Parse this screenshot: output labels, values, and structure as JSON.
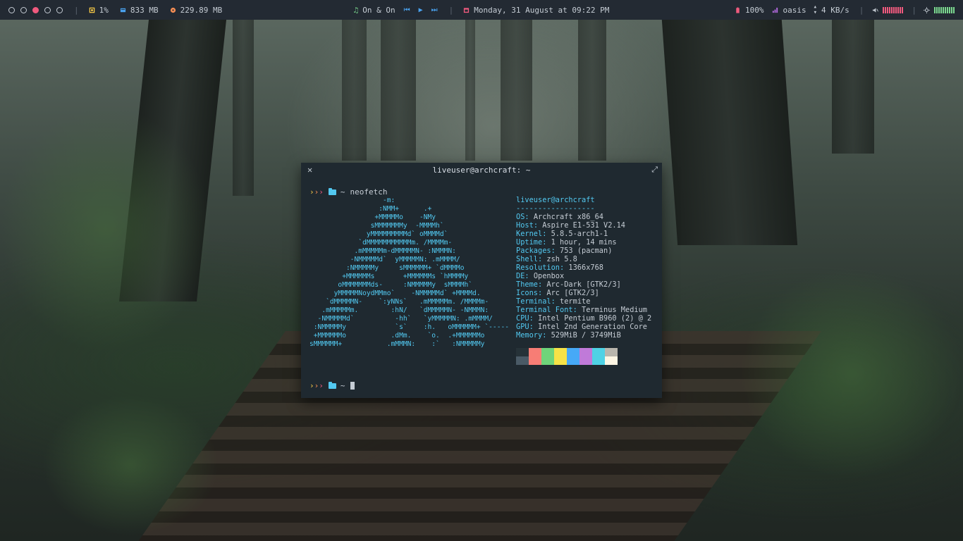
{
  "topbar": {
    "workspaces": [
      {
        "state": "empty"
      },
      {
        "state": "empty"
      },
      {
        "state": "active"
      },
      {
        "state": "empty"
      },
      {
        "state": "empty"
      }
    ],
    "cpu": {
      "value": "1%",
      "icon": "cpu-icon",
      "color": "#f6c945"
    },
    "memory": {
      "value": "833 MB",
      "icon": "memory-icon",
      "color": "#4aa3f0"
    },
    "disk": {
      "value": "229.89 MB",
      "icon": "disk-icon",
      "color": "#f58d54"
    },
    "music": {
      "title": "On & On",
      "icon": "music-note-icon",
      "color": "#7bd88f"
    },
    "date": {
      "value": "Monday, 31 August at 09:22 PM",
      "icon": "calendar-icon",
      "color": "#f05a7e"
    },
    "battery": {
      "value": "100%",
      "icon": "battery-icon",
      "color": "#f05a7e"
    },
    "wifi": {
      "name": "oasis",
      "icon": "wifi-icon",
      "color": "#b86ce6"
    },
    "network": {
      "value": "4 KB/s",
      "icon": "updown-icon"
    },
    "volume": {
      "icon": "speaker-icon",
      "color": "#f05a7e"
    },
    "brightness": {
      "icon": "brightness-icon",
      "color": "#7bd88f"
    }
  },
  "terminal": {
    "title": "liveuser@archcraft: ~",
    "prompt_dir": "~",
    "command": "neofetch",
    "ascii": [
      "                  -m:",
      "                 :NMM+      .+",
      "                +MMMMMo    -NMy",
      "               sMMMMMMMy  -MMMMh`",
      "              yMMMMMMMMMd` oMMMMd`",
      "            `dMMMMMMMMMMMm. /MMMMm-",
      "           .mMMMMMm-dMMMMMN- :NMMMN:",
      "          -NMMMMMd`  yMMMMMN: .mMMMM/",
      "         :NMMMMMy     sMMMMMM+ `dMMMMo",
      "        +MMMMMMs       +MMMMMMs `hMMMMy",
      "       oMMMMMMMds-     :NMMMMMy  sMMMMh`",
      "      yMMMMMNoydMMmo`    -NMMMMMd` +MMMMd.",
      "    `dMMMMMN-    `:yNNs`   .mMMMMMm. /MMMMm-",
      "   .mMMMMMm.        :hN/   `dMMMMMN- -NMMMN:",
      "  -NMMMMMd`          -hh`   `yMMMMMN: .mMMMM/",
      " :NMMMMMy            `s`    :h.   oMMMMMM+ `-----",
      " +MMMMMMo           .dMm.    `o.  .+MMMMMMo",
      "sMMMMMM+           .mMMMN:    :`   :NMMMMMy"
    ],
    "info_user": "liveuser@archcraft",
    "info_sep": "------------------",
    "info": [
      {
        "k": "OS",
        "v": "Archcraft x86_64"
      },
      {
        "k": "Host",
        "v": "Aspire E1-531 V2.14"
      },
      {
        "k": "Kernel",
        "v": "5.8.5-arch1-1"
      },
      {
        "k": "Uptime",
        "v": "1 hour, 14 mins"
      },
      {
        "k": "Packages",
        "v": "753 (pacman)"
      },
      {
        "k": "Shell",
        "v": "zsh 5.8"
      },
      {
        "k": "Resolution",
        "v": "1366x768"
      },
      {
        "k": "DE",
        "v": "Openbox"
      },
      {
        "k": "Theme",
        "v": "Arc-Dark [GTK2/3]"
      },
      {
        "k": "Icons",
        "v": "Arc [GTK2/3]"
      },
      {
        "k": "Terminal",
        "v": "termite"
      },
      {
        "k": "Terminal Font",
        "v": "Terminus Medium"
      },
      {
        "k": "CPU",
        "v": "Intel Pentium B960 (2) @ 2"
      },
      {
        "k": "GPU",
        "v": "Intel 2nd Generation Core"
      },
      {
        "k": "Memory",
        "v": "529MiB / 3749MiB"
      }
    ],
    "palette_top": [
      "#263238",
      "#f77d75",
      "#6fd47a",
      "#f6e247",
      "#46a9f7",
      "#c07ad9",
      "#4fd2e5",
      "#b9b6ad"
    ],
    "palette_bottom": [
      "#4a5a66",
      "#f77d75",
      "#6fd47a",
      "#f6e247",
      "#46a9f7",
      "#c07ad9",
      "#4fd2e5",
      "#fdf6e3"
    ]
  }
}
